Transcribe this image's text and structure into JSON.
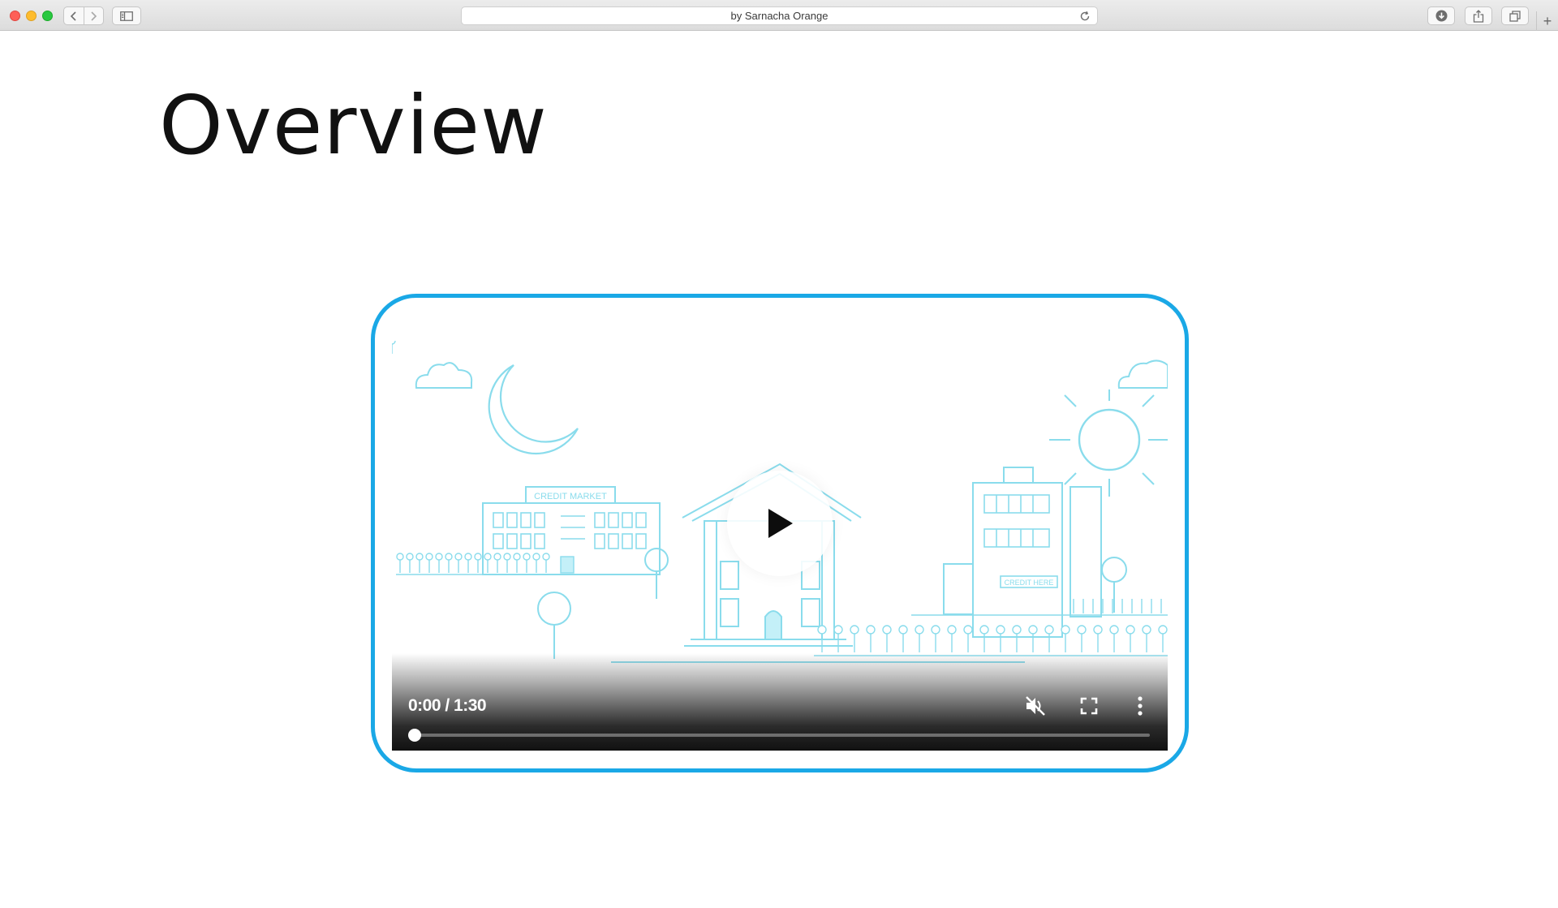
{
  "browser": {
    "url_text": "by Sarnacha Orange",
    "new_tab_symbol": "+"
  },
  "page": {
    "title": "Overview"
  },
  "video": {
    "time_display": "0:00 / 1:30",
    "current_time": "0:00",
    "duration": "1:30",
    "progress_fraction": 0,
    "muted": true,
    "scene_signs": {
      "left_building": "CREDIT MARKET",
      "right_building": "CREDIT HERE"
    },
    "accent_color": "#1aa8e6"
  }
}
